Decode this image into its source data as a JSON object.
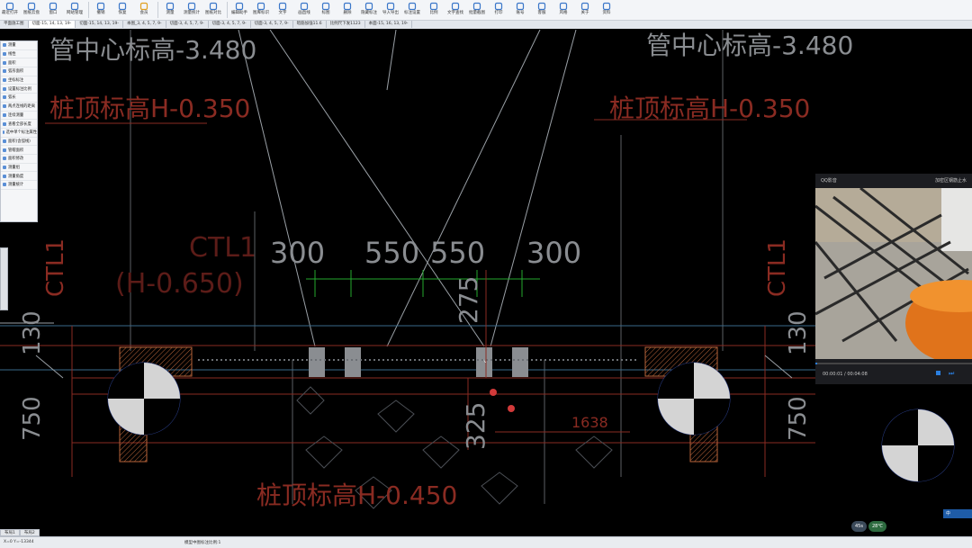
{
  "toolbar": {
    "buttons": [
      {
        "label": "最近打开",
        "icon": "folder-icon"
      },
      {
        "label": "图纸云盘",
        "icon": "cloud-icon"
      },
      {
        "label": "窗口",
        "icon": "close-icon"
      },
      {
        "label": "网站管理",
        "icon": "layers-icon"
      },
      {
        "label": "撤销",
        "icon": "undo-icon"
      },
      {
        "label": "恢复",
        "icon": "redo-icon"
      },
      {
        "label": "会员",
        "icon": "vip-icon"
      },
      {
        "label": "测量",
        "icon": "measure-icon"
      },
      {
        "label": "测量统计",
        "icon": "list-icon"
      },
      {
        "label": "图纸对比",
        "icon": "compare-icon"
      },
      {
        "label": "编辑助手",
        "icon": "edit-icon"
      },
      {
        "label": "图库标识",
        "icon": "frame-icon"
      },
      {
        "label": "文字",
        "icon": "text-icon"
      },
      {
        "label": "画直线",
        "icon": "line-icon"
      },
      {
        "label": "标图",
        "icon": "cloud-mark-icon"
      },
      {
        "label": "删除",
        "icon": "eraser-icon"
      },
      {
        "label": "隐藏标注",
        "icon": "eye-icon"
      },
      {
        "label": "导入导出",
        "icon": "import-icon"
      },
      {
        "label": "标注设置",
        "icon": "settings-icon"
      },
      {
        "label": "比例",
        "icon": "scale-icon"
      },
      {
        "label": "文字查找",
        "icon": "search-icon"
      },
      {
        "label": "批量截图",
        "icon": "screenshot-icon"
      },
      {
        "label": "打印",
        "icon": "print-icon"
      },
      {
        "label": "账号",
        "icon": "user-icon"
      },
      {
        "label": "客服",
        "icon": "headset-icon"
      },
      {
        "label": "风格",
        "icon": "share-icon"
      },
      {
        "label": "关于",
        "icon": "info-icon"
      },
      {
        "label": "资料",
        "icon": "book-icon"
      }
    ]
  },
  "tabs": [
    {
      "label": "平面施工图",
      "active": false
    },
    {
      "label": "切面-15, 14, 13, 19-",
      "active": true
    },
    {
      "label": "切面-15, 14, 13, 19-",
      "active": false
    },
    {
      "label": "本图_3, 4, 5, 7, 9-",
      "active": false
    },
    {
      "label": "切面-3, 4, 5, 7, 9-",
      "active": false
    },
    {
      "label": "切面-3, 4, 5, 7, 9-",
      "active": false
    },
    {
      "label": "切面-3, 4, 5, 7, 9-",
      "active": false
    },
    {
      "label": "暗筋加强11.6",
      "active": false
    },
    {
      "label": "比例尺下发1123",
      "active": false
    },
    {
      "label": "本面-15, 16, 13, 19-",
      "active": false
    }
  ],
  "side_panel": {
    "items": [
      "测量",
      "线性",
      "面积",
      "弧形面积",
      "坐标标注",
      "设置标注比例",
      "弧长",
      "两点连线的距离",
      "连续测量",
      "查看全部长度",
      "选中单个标注属性",
      "面积(含弧线)",
      "管帽面积",
      "面积修改",
      "测量组",
      "测量角度",
      "测量统计"
    ]
  },
  "cad": {
    "elev_top_left": "管中心标高-3.480",
    "elev_top_right": "管中心标高-3.480",
    "pile_top_left": "桩顶标高H-0.350",
    "pile_top_right": "桩顶标高H-0.350",
    "pile_bottom": "桩顶标高H-0.450",
    "ctl_label": "CTL1",
    "ctl_elev": "(H-0.650)",
    "dim_300_a": "300",
    "dim_550_a": "550",
    "dim_550_b": "550",
    "dim_300_b": "300",
    "dim_275": "275",
    "dim_325": "325",
    "dim_1638": "1638",
    "dim_130_left": "130",
    "dim_130_right": "130",
    "dim_750_left": "750",
    "dim_750_right": "750",
    "ctl_vertical_left": "CTL1",
    "ctl_vertical_right": "CTL1"
  },
  "video": {
    "title": "QQ影音",
    "right_label": "加密区钢筋止水",
    "time": "00:00:01 / 00:04:08"
  },
  "layout_tabs": [
    "布局1",
    "布局2"
  ],
  "status": {
    "coords": "X=0  Y=-13344",
    "center_text": "模型中图标注比例:1"
  },
  "tray": {
    "speed": "45s",
    "temp": "28℃",
    "ime": "中"
  },
  "colors": {
    "cad_red": "#8a2b22",
    "cad_gray": "#9aa0a6",
    "cad_green": "#23a82e",
    "cad_orange": "#b9653a",
    "cad_blue": "#2a6fd6"
  }
}
